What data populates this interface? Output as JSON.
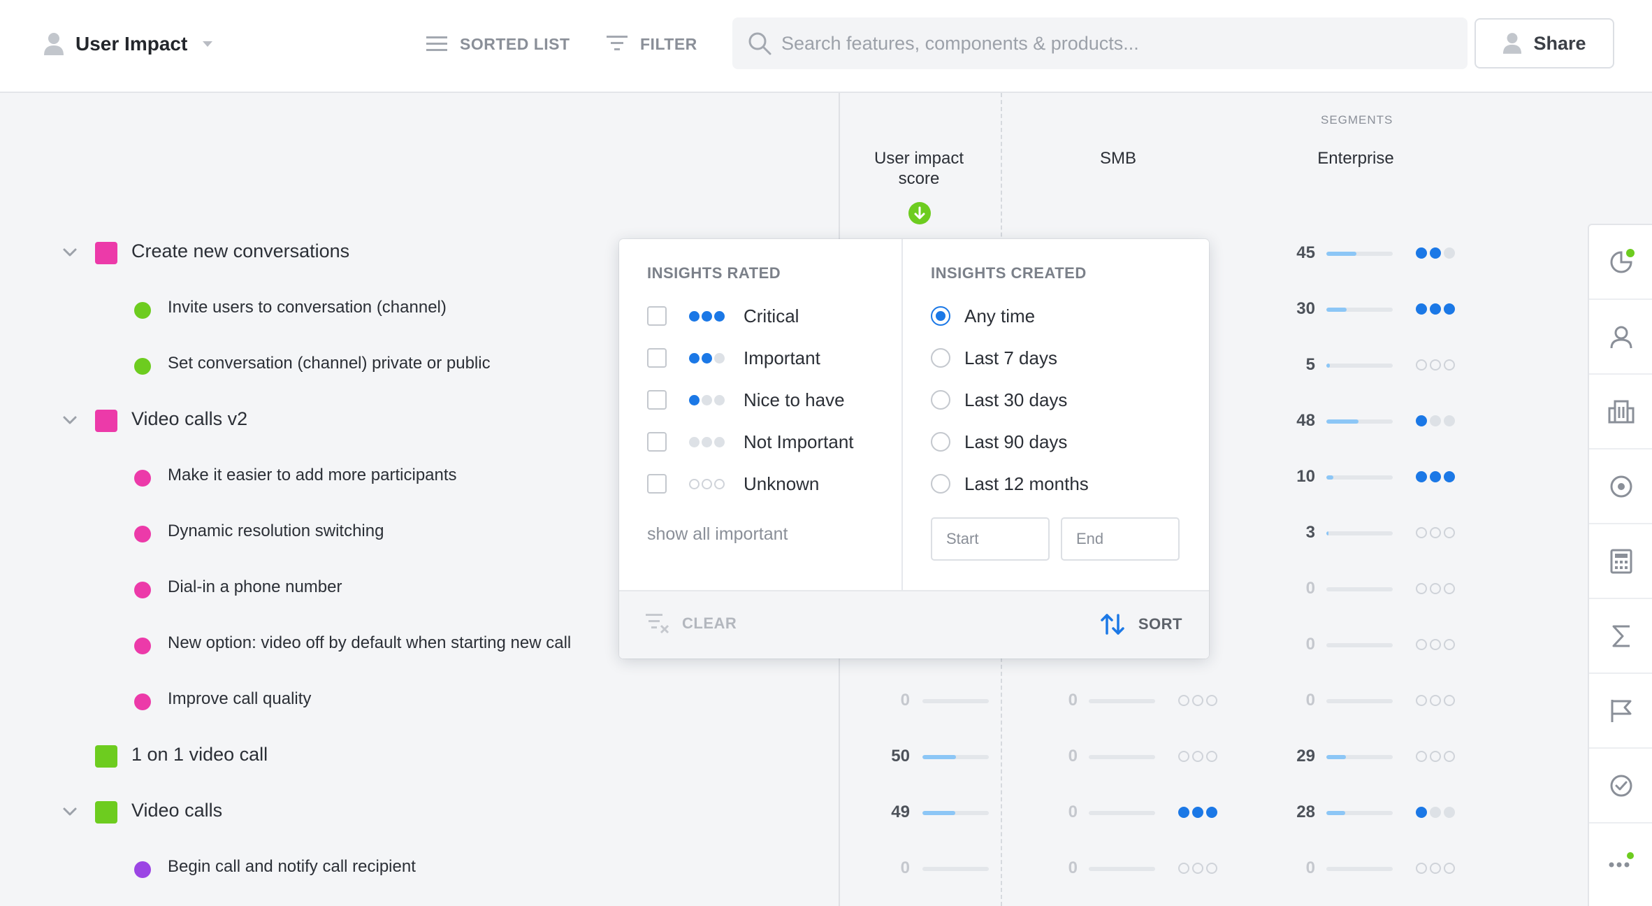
{
  "header": {
    "view_name": "User Impact",
    "sorted_list_label": "SORTED LIST",
    "filter_label": "FILTER",
    "search_placeholder": "Search features, components & products...",
    "share_label": "Share"
  },
  "columns": {
    "segments_label": "SEGMENTS",
    "user_impact_line1": "User impact",
    "user_impact_line2": "score",
    "smb": "SMB",
    "enterprise": "Enterprise"
  },
  "colors": {
    "pink": "#ec3aa9",
    "green": "#6dcc1f",
    "purple": "#9b45e4",
    "blue": "#1b78e6"
  },
  "rows": [
    {
      "name": "Create new conversations",
      "level": "parent",
      "marker": "#ec3aa9",
      "expanded": true,
      "uis": null,
      "smb": null,
      "smb_dots": null,
      "ent": "45",
      "ent_fill": 0.45,
      "ent_dots": "2"
    },
    {
      "name": "Invite users to conversation (channel)",
      "level": "child",
      "marker": "#6dcc1f",
      "uis": null,
      "smb": null,
      "smb_dots": null,
      "ent": "30",
      "ent_fill": 0.3,
      "ent_dots": "3"
    },
    {
      "name": "Set conversation (channel) private or public",
      "level": "child",
      "marker": "#6dcc1f",
      "uis": null,
      "smb": null,
      "smb_dots": null,
      "ent": "5",
      "ent_fill": 0.05,
      "ent_dots": "0"
    },
    {
      "name": "Video calls v2",
      "level": "parent",
      "marker": "#ec3aa9",
      "expanded": true,
      "uis": null,
      "smb": null,
      "smb_dots": null,
      "ent": "48",
      "ent_fill": 0.48,
      "ent_dots": "1"
    },
    {
      "name": "Make it easier to add more participants",
      "level": "child",
      "marker": "#ec3aa9",
      "uis": null,
      "smb": null,
      "smb_dots": null,
      "ent": "10",
      "ent_fill": 0.1,
      "ent_dots": "3"
    },
    {
      "name": "Dynamic resolution switching",
      "level": "child",
      "marker": "#ec3aa9",
      "uis": null,
      "smb": null,
      "smb_dots": null,
      "ent": "3",
      "ent_fill": 0.03,
      "ent_dots": "0"
    },
    {
      "name": "Dial-in a phone number",
      "level": "child",
      "marker": "#ec3aa9",
      "uis": null,
      "smb": null,
      "smb_dots": null,
      "ent": "0",
      "ent_fill": 0,
      "ent_dots": "0"
    },
    {
      "name": "New option: video off by default when starting new call",
      "level": "child",
      "marker": "#ec3aa9",
      "uis": null,
      "smb": null,
      "smb_dots": null,
      "ent": "0",
      "ent_fill": 0,
      "ent_dots": "0"
    },
    {
      "name": "Improve call quality",
      "level": "child",
      "marker": "#ec3aa9",
      "uis": "0",
      "uis_fill": 0,
      "smb": "0",
      "smb_fill": 0,
      "smb_dots": "0",
      "ent": "0",
      "ent_fill": 0,
      "ent_dots": "0"
    },
    {
      "name": "1 on 1 video call",
      "level": "parent-noexpand",
      "marker": "#6dcc1f",
      "uis": "50",
      "uis_fill": 0.5,
      "smb": "0",
      "smb_fill": 0,
      "smb_dots": "0",
      "ent": "29",
      "ent_fill": 0.29,
      "ent_dots": "0"
    },
    {
      "name": "Video calls",
      "level": "parent",
      "marker": "#6dcc1f",
      "expanded": true,
      "uis": "49",
      "uis_fill": 0.49,
      "smb": "0",
      "smb_fill": 0,
      "smb_dots": "3",
      "ent": "28",
      "ent_fill": 0.28,
      "ent_dots": "1"
    },
    {
      "name": "Begin call and notify call recipient",
      "level": "child",
      "marker": "#9b45e4",
      "uis": "0",
      "uis_fill": 0,
      "smb": "0",
      "smb_fill": 0,
      "smb_dots": "0",
      "ent": "0",
      "ent_fill": 0,
      "ent_dots": "0"
    }
  ],
  "popover": {
    "rated_title": "INSIGHTS RATED",
    "rated_options": [
      {
        "label": "Critical",
        "level": 3
      },
      {
        "label": "Important",
        "level": 2
      },
      {
        "label": "Nice to have",
        "level": 1
      },
      {
        "label": "Not Important",
        "level": 0
      },
      {
        "label": "Unknown",
        "level": -1
      }
    ],
    "show_all": "show all important",
    "created_title": "INSIGHTS CREATED",
    "created_options": [
      {
        "label": "Any time",
        "selected": true
      },
      {
        "label": "Last 7 days",
        "selected": false
      },
      {
        "label": "Last 30 days",
        "selected": false
      },
      {
        "label": "Last 90 days",
        "selected": false
      },
      {
        "label": "Last 12 months",
        "selected": false
      }
    ],
    "start_placeholder": "Start",
    "end_placeholder": "End",
    "clear_label": "CLEAR",
    "sort_label": "SORT"
  },
  "right_rail": [
    "chart-icon",
    "person-icon",
    "building-icon",
    "target-icon",
    "calculator-icon",
    "sigma-icon",
    "flag-icon",
    "check-circle-icon",
    "more-icon"
  ]
}
